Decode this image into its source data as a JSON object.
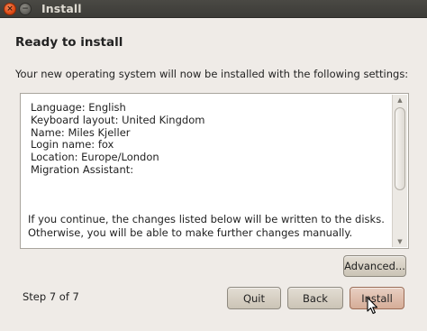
{
  "window": {
    "title": "Install",
    "close_glyph": "×",
    "minimize_glyph": "−"
  },
  "page": {
    "title": "Ready to install",
    "intro": "Your new operating system will now be installed with the following settings:"
  },
  "summary": {
    "lines": [
      "Language: English",
      "Keyboard layout: United Kingdom",
      "Name: Miles Kjeller",
      "Login name: fox",
      "Location: Europe/London",
      "Migration Assistant:"
    ],
    "footer_line1": "If you continue, the changes listed below will be written to the disks.",
    "footer_line2": "Otherwise, you will be able to make further changes manually."
  },
  "buttons": {
    "advanced": "Advanced...",
    "quit": "Quit",
    "back": "Back",
    "install": "Install"
  },
  "step": "Step 7 of 7",
  "icons": {
    "close": "close-icon",
    "minimize": "minimize-icon",
    "cursor": "mouse-pointer-icon"
  },
  "colors": {
    "titlebar": "#3c3b37",
    "close_button": "#df4b16",
    "window_bg": "#efebe7",
    "install_button": "#d6ad98"
  }
}
